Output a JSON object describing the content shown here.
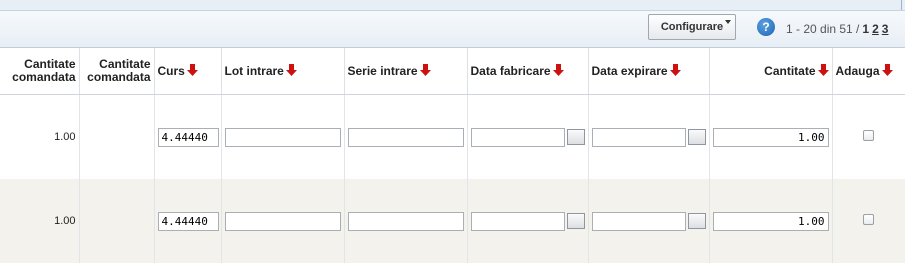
{
  "toolbar": {
    "configure_label": "Configurare",
    "help_glyph": "?",
    "pager": {
      "range": "1 - 20 din 51 /",
      "current": "1",
      "pages": [
        "2",
        "3"
      ]
    }
  },
  "columns": [
    {
      "key": "qty_ordered_1",
      "label_lines": [
        "Cantitate",
        "comandata"
      ],
      "sortable": false
    },
    {
      "key": "qty_ordered_2",
      "label_lines": [
        "Cantitate",
        "comandata"
      ],
      "sortable": false
    },
    {
      "key": "curs",
      "label": "Curs",
      "sortable": true
    },
    {
      "key": "lot",
      "label": "Lot intrare",
      "sortable": true
    },
    {
      "key": "serie",
      "label": "Serie intrare",
      "sortable": true
    },
    {
      "key": "data_fabricare",
      "label": "Data fabricare",
      "sortable": true
    },
    {
      "key": "data_expirare",
      "label": "Data expirare",
      "sortable": true
    },
    {
      "key": "cantitate",
      "label": "Cantitate",
      "sortable": true
    },
    {
      "key": "adauga",
      "label": "Adauga",
      "sortable": true
    }
  ],
  "rows": [
    {
      "qty_ordered": "1.00",
      "qty_ordered_2": "",
      "curs": "4.44440",
      "lot": "",
      "serie": "",
      "data_fabricare": "",
      "data_expirare": "",
      "cantitate": "1.00",
      "adauga": false
    },
    {
      "qty_ordered": "1.00",
      "qty_ordered_2": "",
      "curs": "4.44440",
      "lot": "",
      "serie": "",
      "data_fabricare": "",
      "data_expirare": "",
      "cantitate": "1.00",
      "adauga": false
    }
  ],
  "colors": {
    "sort_arrow": "#cc1111",
    "row_alt_bg": "#f4f2ec",
    "toolbar_bg": "#e7eef5"
  },
  "icons": {
    "sort": "sort-down-arrow-icon",
    "calendar": "calendar-icon",
    "help": "help-icon"
  }
}
